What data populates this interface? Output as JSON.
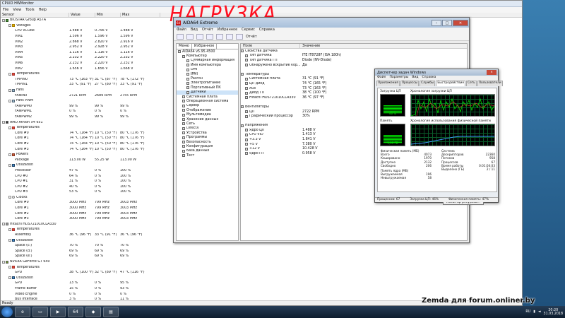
{
  "overlay_title": "НАГРУЗКА",
  "watermark": "Zemda для forum.onliner.by",
  "hwmonitor": {
    "title": "CPUID HWMonitor",
    "menu": [
      "File",
      "View",
      "Tools",
      "Help"
    ],
    "columns": [
      "Sensor",
      "Value",
      "Min",
      "Max"
    ],
    "rows": [
      {
        "d": 0,
        "exp": "-",
        "icon": "chip",
        "name": "BIOSTAR Group A57A",
        "v": "",
        "mi": "",
        "mx": ""
      },
      {
        "d": 1,
        "exp": "-",
        "icon": "volt",
        "name": "Voltages",
        "v": "",
        "mi": "",
        "mx": ""
      },
      {
        "d": 2,
        "name": "CPU VCORE",
        "v": "1.488 V",
        "mi": "0.756 V",
        "mx": "1.488 V"
      },
      {
        "d": 2,
        "name": "VIN1",
        "v": "1.596 V",
        "mi": "1.596 V",
        "mx": "1.596 V"
      },
      {
        "d": 2,
        "name": "VIN2",
        "v": "2.868 V",
        "mi": "2.820 V",
        "mx": "2.916 V"
      },
      {
        "d": 2,
        "name": "VIN3",
        "v": "2.952 V",
        "mi": "2.928 V",
        "mx": "2.952 V"
      },
      {
        "d": 2,
        "name": "VIN4",
        "v": "1.116 V",
        "mi": "1.116 V",
        "mx": "1.116 V"
      },
      {
        "d": 2,
        "name": "VIN5",
        "v": "2.232 V",
        "mi": "2.220 V",
        "mx": "2.232 V"
      },
      {
        "d": 2,
        "name": "VIN6",
        "v": "2.232 V",
        "mi": "2.220 V",
        "mx": "2.232 V"
      },
      {
        "d": 2,
        "name": "VIN7",
        "v": "1.656 V",
        "mi": "1.656 V",
        "mx": "1.668 V"
      },
      {
        "d": 1,
        "exp": "-",
        "icon": "temp",
        "name": "Temperatures",
        "v": "",
        "mi": "",
        "mx": ""
      },
      {
        "d": 2,
        "name": "TMPIN0",
        "v": "73 °C (163 °F)",
        "mi": "31 °C (87 °F)",
        "mx": "78 °C (172 °F)"
      },
      {
        "d": 2,
        "name": "TMPIN1",
        "v": "33 °C (91 °F)",
        "mi": "27 °C (80 °F)",
        "mx": "33 °C (91 °F)"
      },
      {
        "d": 1,
        "exp": "-",
        "icon": "fan",
        "name": "Fans",
        "v": "",
        "mi": "",
        "mx": ""
      },
      {
        "d": 2,
        "name": "FANIN0",
        "v": "2721 RPM",
        "mi": "2689 RPM",
        "mx": "2755 RPM"
      },
      {
        "d": 1,
        "exp": "-",
        "icon": "fan",
        "name": "Fans PWM",
        "v": "",
        "mi": "",
        "mx": ""
      },
      {
        "d": 2,
        "name": "FANPWM0",
        "v": "99 %",
        "mi": "99 %",
        "mx": "99 %"
      },
      {
        "d": 2,
        "name": "FANPWM1",
        "v": "0 %",
        "mi": "0 %",
        "mx": "0 %"
      },
      {
        "d": 2,
        "name": "FANPWM2",
        "v": "99 %",
        "mi": "99 %",
        "mx": "99 %"
      },
      {
        "d": 0,
        "exp": "-",
        "icon": "cpu",
        "name": "AMD Athlon X4 651",
        "v": "",
        "mi": "",
        "mx": ""
      },
      {
        "d": 1,
        "exp": "-",
        "icon": "temp",
        "name": "Temperatures",
        "v": "",
        "mi": "",
        "mx": ""
      },
      {
        "d": 2,
        "name": "Core #0",
        "v": "74 °C (164 °F)",
        "mi": "10 °C (50 °F)",
        "mx": "80 °C (176 °F)"
      },
      {
        "d": 2,
        "name": "Core #1",
        "v": "74 °C (164 °F)",
        "mi": "10 °C (50 °F)",
        "mx": "80 °C (176 °F)"
      },
      {
        "d": 2,
        "name": "Core #2",
        "v": "74 °C (164 °F)",
        "mi": "10 °C (50 °F)",
        "mx": "80 °C (176 °F)"
      },
      {
        "d": 2,
        "name": "Core #3",
        "v": "74 °C (164 °F)",
        "mi": "10 °C (50 °F)",
        "mx": "80 °C (176 °F)"
      },
      {
        "d": 1,
        "exp": "-",
        "icon": "pow",
        "name": "Powers",
        "v": "",
        "mi": "",
        "mx": ""
      },
      {
        "d": 2,
        "name": "Package",
        "v": "113.00 W",
        "mi": "55.25 W",
        "mx": "113.00 W"
      },
      {
        "d": 1,
        "exp": "-",
        "icon": "util",
        "name": "Utilization",
        "v": "",
        "mi": "",
        "mx": ""
      },
      {
        "d": 2,
        "name": "Processor",
        "v": "47 %",
        "mi": "0 %",
        "mx": "100 %"
      },
      {
        "d": 2,
        "name": "CPU #0",
        "v": "64 %",
        "mi": "0 %",
        "mx": "100 %"
      },
      {
        "d": 2,
        "name": "CPU #1",
        "v": "31 %",
        "mi": "0 %",
        "mx": "100 %"
      },
      {
        "d": 2,
        "name": "CPU #2",
        "v": "40 %",
        "mi": "0 %",
        "mx": "100 %"
      },
      {
        "d": 2,
        "name": "CPU #3",
        "v": "53 %",
        "mi": "0 %",
        "mx": "100 %"
      },
      {
        "d": 1,
        "exp": "-",
        "icon": "clk",
        "name": "Clocks",
        "v": "",
        "mi": "",
        "mx": ""
      },
      {
        "d": 2,
        "name": "Core #0",
        "v": "3000 MHz",
        "mi": "799 MHz",
        "mx": "3003 MHz"
      },
      {
        "d": 2,
        "name": "Core #1",
        "v": "3000 MHz",
        "mi": "799 MHz",
        "mx": "3003 MHz"
      },
      {
        "d": 2,
        "name": "Core #2",
        "v": "3000 MHz",
        "mi": "799 MHz",
        "mx": "3003 MHz"
      },
      {
        "d": 2,
        "name": "Core #3",
        "v": "3000 MHz",
        "mi": "799 MHz",
        "mx": "3003 MHz"
      },
      {
        "d": 0,
        "exp": "-",
        "icon": "hdd",
        "name": "Hitachi HDS721010CLA330",
        "v": "",
        "mi": "",
        "mx": ""
      },
      {
        "d": 1,
        "exp": "-",
        "icon": "temp",
        "name": "Temperatures",
        "v": "",
        "mi": "",
        "mx": ""
      },
      {
        "d": 2,
        "name": "Assembly",
        "v": "36 °C (96 °F)",
        "mi": "33 °C (91 °F)",
        "mx": "36 °C (96 °F)"
      },
      {
        "d": 1,
        "exp": "-",
        "icon": "util",
        "name": "Utilization",
        "v": "",
        "mi": "",
        "mx": ""
      },
      {
        "d": 2,
        "name": "Space (c:)",
        "v": "70 %",
        "mi": "70 %",
        "mx": "70 %"
      },
      {
        "d": 2,
        "name": "Space (d:)",
        "v": "69 %",
        "mi": "69 %",
        "mx": "69 %"
      },
      {
        "d": 2,
        "name": "Space (e:)",
        "v": "69 %",
        "mi": "69 %",
        "mx": "69 %"
      },
      {
        "d": 0,
        "exp": "-",
        "icon": "gpu",
        "name": "NVIDIA GeForce GT 640",
        "v": "",
        "mi": "",
        "mx": ""
      },
      {
        "d": 1,
        "exp": "-",
        "icon": "temp",
        "name": "Temperatures",
        "v": "",
        "mi": "",
        "mx": ""
      },
      {
        "d": 2,
        "name": "GPU",
        "v": "38 °C (100 °F)",
        "mi": "32 °C (89 °F)",
        "mx": "47 °C (116 °F)"
      },
      {
        "d": 1,
        "exp": "-",
        "icon": "util",
        "name": "Utilization",
        "v": "",
        "mi": "",
        "mx": ""
      },
      {
        "d": 2,
        "name": "GPU",
        "v": "13 %",
        "mi": "0 %",
        "mx": "95 %"
      },
      {
        "d": 2,
        "name": "Frame Buffer",
        "v": "15 %",
        "mi": "0 %",
        "mx": "93 %"
      },
      {
        "d": 2,
        "name": "Video Engine",
        "v": "0 %",
        "mi": "0 %",
        "mx": "0 %"
      },
      {
        "d": 2,
        "name": "Bus Interface",
        "v": "3 %",
        "mi": "0 %",
        "mx": "11 %"
      }
    ],
    "status": "Ready"
  },
  "aida": {
    "title": "AIDA64 Extreme",
    "menu": [
      "Файл",
      "Вид",
      "Отчёт",
      "Избранное",
      "Сервис",
      "Справка"
    ],
    "report_btn": "Отчёт",
    "tabs": [
      "Меню",
      "Избранное"
    ],
    "tree": [
      {
        "d": 0,
        "icon": "aida",
        "name": "AIDA64 v5.95.4500"
      },
      {
        "d": 1,
        "icon": "pc",
        "name": "Компьютер"
      },
      {
        "d": 2,
        "icon": "doc",
        "name": "Суммарная информация"
      },
      {
        "d": 2,
        "icon": "doc",
        "name": "Имя компьютера"
      },
      {
        "d": 2,
        "icon": "doc",
        "name": "DMI"
      },
      {
        "d": 2,
        "icon": "doc",
        "name": "IPMI"
      },
      {
        "d": 2,
        "icon": "doc",
        "name": "Разгон"
      },
      {
        "d": 2,
        "icon": "doc",
        "name": "Электропитание"
      },
      {
        "d": 2,
        "icon": "doc",
        "name": "Портативный ПК"
      },
      {
        "d": 2,
        "icon": "sens",
        "name": "Датчики",
        "sel": true
      },
      {
        "d": 1,
        "icon": "mb",
        "name": "Системная плата"
      },
      {
        "d": 1,
        "icon": "os",
        "name": "Операционная система"
      },
      {
        "d": 1,
        "icon": "srv",
        "name": "Сервер"
      },
      {
        "d": 1,
        "icon": "disp",
        "name": "Отображение"
      },
      {
        "d": 1,
        "icon": "mm",
        "name": "Мультимедиа"
      },
      {
        "d": 1,
        "icon": "hdd",
        "name": "Хранение данных"
      },
      {
        "d": 1,
        "icon": "net",
        "name": "Сеть"
      },
      {
        "d": 1,
        "icon": "dx",
        "name": "DirectX"
      },
      {
        "d": 1,
        "icon": "dev",
        "name": "Устройства"
      },
      {
        "d": 1,
        "icon": "prog",
        "name": "Программы"
      },
      {
        "d": 1,
        "icon": "sec",
        "name": "Безопасность"
      },
      {
        "d": 1,
        "icon": "cfg",
        "name": "Конфигурация"
      },
      {
        "d": 1,
        "icon": "db",
        "name": "База данных"
      },
      {
        "d": 1,
        "icon": "test",
        "name": "Тест"
      }
    ],
    "col_field": "Поле",
    "col_value": "Значение",
    "rows": [
      {
        "sec": true,
        "f": "Свойства датчика",
        "v": ""
      },
      {
        "f": "Тип датчика",
        "v": "ITE IT8728F (ISA 180h)"
      },
      {
        "f": "Тип датчика ГП",
        "v": "Diode (NV-Diode)"
      },
      {
        "f": "Обнаружено вскрытие кор...",
        "v": "Да"
      },
      {
        "gap": true
      },
      {
        "sec": true,
        "f": "Температуры",
        "v": ""
      },
      {
        "f": "Системная плата",
        "v": "31 °C (91 °F)"
      },
      {
        "f": "ЦП диод",
        "v": "74 °C (165 °F)"
      },
      {
        "f": "Aux",
        "v": "73 °C (163 °F)"
      },
      {
        "f": "Диод ГП",
        "v": "38 °C (100 °F)"
      },
      {
        "f": "Hitachi HDS721010CLA330",
        "v": "36 °C (97 °F)"
      },
      {
        "gap": true
      },
      {
        "sec": true,
        "f": "Вентиляторы",
        "v": ""
      },
      {
        "f": "ЦП",
        "v": "2722 RPM"
      },
      {
        "f": "Графический процессор",
        "v": "30%"
      },
      {
        "gap": true
      },
      {
        "sec": true,
        "f": "Напряжения",
        "v": ""
      },
      {
        "f": "Ядро ЦП",
        "v": "1.488 V"
      },
      {
        "f": "CPU VID",
        "v": "1.413 V"
      },
      {
        "f": "+3.3 V",
        "v": "1.841 V"
      },
      {
        "f": "+5 V",
        "v": "7.380 V"
      },
      {
        "f": "+12 V",
        "v": "10.428 V"
      },
      {
        "f": "Ядро ГП",
        "v": "0.958 V"
      }
    ]
  },
  "taskmgr": {
    "title": "Диспетчер задач Windows",
    "menu": [
      "Файл",
      "Параметры",
      "Вид",
      "Справка"
    ],
    "tabs": [
      "Приложения",
      "Процессы",
      "Службы",
      "Быстродействие",
      "Сеть",
      "Пользователи"
    ],
    "active_tab": "Быстродействие",
    "cpu_label": "Загрузка ЦП",
    "cpu_pct": "46 %",
    "cpu_level": 0.46,
    "cpu_hist_label": "Хронология загрузки ЦП",
    "mem_label": "Память",
    "mem_value": "1,99 ГБ",
    "mem_level": 0.48,
    "mem_hist_label": "Хронология использования физической памяти",
    "phys_title": "Физическая память (МБ)",
    "phys": [
      [
        "Всего",
        "4073"
      ],
      [
        "Кэшировано",
        "1970"
      ],
      [
        "Доступно",
        "2132"
      ],
      [
        "Свободно",
        "206"
      ]
    ],
    "sys_title": "Система",
    "sys": [
      [
        "Дескрипторов",
        "22360"
      ],
      [
        "Потоков",
        "958"
      ],
      [
        "Процессов",
        "67"
      ],
      [
        "Время работы",
        "0:01:04:03"
      ],
      [
        "Выделено (ГБ)",
        "2 / 11"
      ]
    ],
    "kern_title": "Память ядра (МБ)",
    "kern": [
      [
        "Выгружаемая",
        "196"
      ],
      [
        "Невыгружаемая",
        "58"
      ]
    ],
    "resmon_btn": "Монитор ресурсов...",
    "status": [
      "Процессов: 67",
      "Загрузка ЦП: 46%",
      "Физическая память: 47%"
    ]
  },
  "taskbar": {
    "apps": [
      "ie",
      "explorer",
      "media",
      "aida64",
      "hwmon",
      "taskmgr"
    ],
    "lang": "RU",
    "time": "20:20",
    "date": "31.03.2018"
  }
}
